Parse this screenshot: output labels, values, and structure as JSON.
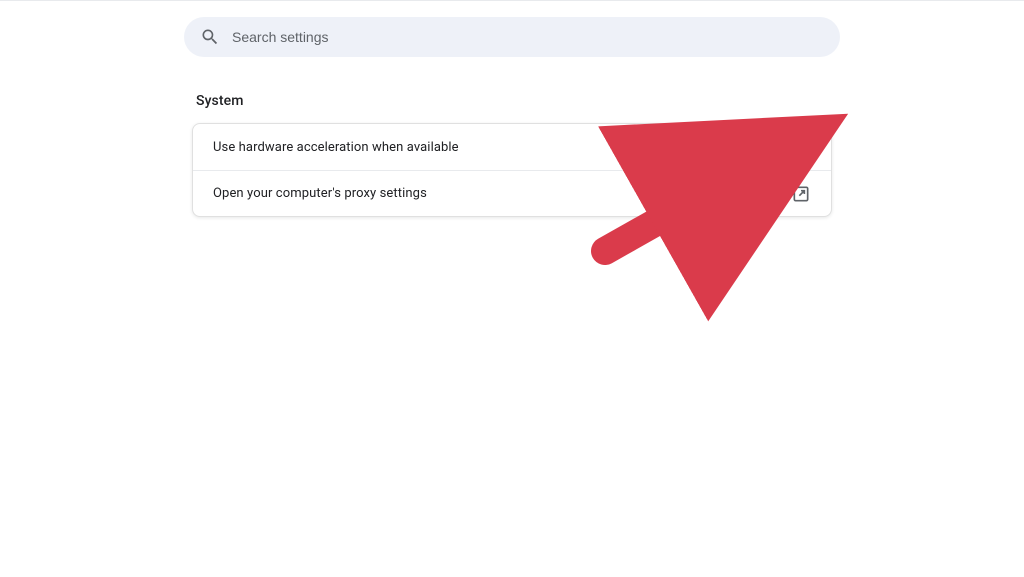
{
  "search": {
    "placeholder": "Search settings"
  },
  "section": {
    "title": "System"
  },
  "rows": {
    "hwaccel": {
      "label": "Use hardware acceleration when available",
      "enabled": true
    },
    "proxy": {
      "label": "Open your computer's proxy settings"
    }
  },
  "colors": {
    "accent": "#0b57d0",
    "annotation": "#DA3B4B"
  }
}
